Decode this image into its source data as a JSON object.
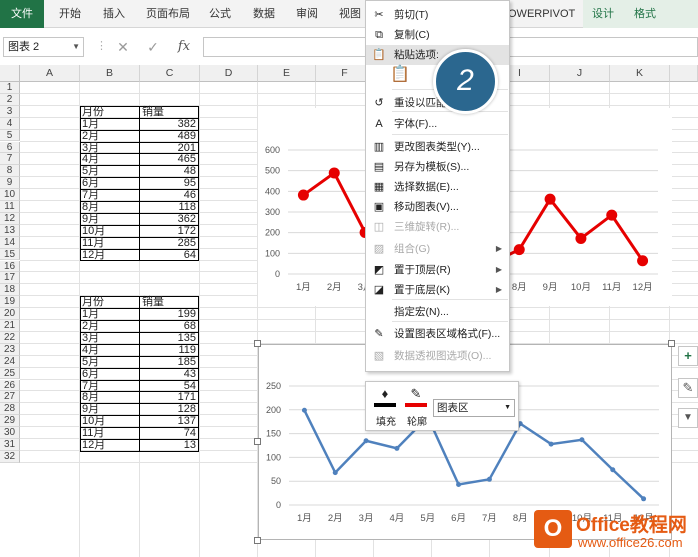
{
  "ribbon": {
    "tabs": [
      "文件",
      "开始",
      "插入",
      "页面布局",
      "公式",
      "数据",
      "审阅",
      "视图"
    ],
    "tab_partial": "OWERPIVOT",
    "context_tabs": [
      "设计",
      "格式"
    ]
  },
  "formula_bar": {
    "name_box": "图表 2",
    "cancel_icon": "✕",
    "enter_icon": "✓",
    "fx_label": "fx",
    "value": ""
  },
  "columns": [
    "A",
    "B",
    "C",
    "D",
    "E",
    "F",
    "G",
    "H",
    "I",
    "J",
    "K"
  ],
  "rows": [
    "1",
    "2",
    "3",
    "4",
    "5",
    "6",
    "7",
    "8",
    "9",
    "10",
    "11",
    "12",
    "13",
    "14",
    "15",
    "16",
    "17",
    "18",
    "19",
    "20",
    "21",
    "22",
    "23",
    "24",
    "25",
    "26",
    "27",
    "28",
    "29",
    "30",
    "31",
    "32"
  ],
  "table1": {
    "headers": [
      "月份",
      "销量"
    ],
    "rows": [
      [
        "1月",
        "382"
      ],
      [
        "2月",
        "489"
      ],
      [
        "3月",
        "201"
      ],
      [
        "4月",
        "465"
      ],
      [
        "5月",
        "48"
      ],
      [
        "6月",
        "95"
      ],
      [
        "7月",
        "46"
      ],
      [
        "8月",
        "118"
      ],
      [
        "9月",
        "362"
      ],
      [
        "10月",
        "172"
      ],
      [
        "11月",
        "285"
      ],
      [
        "12月",
        "64"
      ]
    ]
  },
  "table2": {
    "headers": [
      "月份",
      "销量"
    ],
    "rows": [
      [
        "1月",
        "199"
      ],
      [
        "2月",
        "68"
      ],
      [
        "3月",
        "135"
      ],
      [
        "4月",
        "119"
      ],
      [
        "5月",
        "185"
      ],
      [
        "6月",
        "43"
      ],
      [
        "7月",
        "54"
      ],
      [
        "8月",
        "171"
      ],
      [
        "9月",
        "128"
      ],
      [
        "10月",
        "137"
      ],
      [
        "11月",
        "74"
      ],
      [
        "12月",
        "13"
      ]
    ]
  },
  "chart_data": [
    {
      "type": "line",
      "categories": [
        "1月",
        "2月",
        "3月",
        "4月",
        "5月",
        "6月",
        "7月",
        "8月",
        "9月",
        "10月",
        "11月",
        "12月"
      ],
      "series": [
        {
          "values": [
            382,
            489,
            201,
            465,
            48,
            95,
            46,
            118,
            362,
            172,
            285,
            64
          ]
        }
      ],
      "yticks": [
        0,
        100,
        200,
        300,
        400,
        500,
        600
      ],
      "ylim": [
        0,
        600
      ],
      "color": "#e60000",
      "markers": true
    },
    {
      "type": "line",
      "categories": [
        "1月",
        "2月",
        "3月",
        "4月",
        "5月",
        "6月",
        "7月",
        "8月",
        "9月",
        "10月",
        "11月",
        "12月"
      ],
      "series": [
        {
          "values": [
            199,
            68,
            135,
            119,
            185,
            43,
            54,
            171,
            128,
            137,
            74,
            13
          ]
        }
      ],
      "yticks": [
        0,
        50,
        100,
        150,
        200,
        250
      ],
      "ylim": [
        0,
        250
      ],
      "color": "#4f81bd",
      "markers": true
    }
  ],
  "context_menu": {
    "items": [
      {
        "label": "剪切(T)",
        "icon": "✂",
        "disabled": false,
        "arrow": false
      },
      {
        "label": "复制(C)",
        "icon": "⧉",
        "disabled": false,
        "arrow": false
      },
      {
        "label": "粘贴选项:",
        "icon": "📋",
        "disabled": false,
        "arrow": false
      },
      {
        "label": "",
        "icon": "📋",
        "disabled": false,
        "arrow": false
      },
      {
        "label": "重设以匹配样式(A)",
        "icon": "↺",
        "disabled": false,
        "arrow": false
      },
      {
        "label": "字体(F)...",
        "icon": "A",
        "disabled": false,
        "arrow": false
      },
      {
        "label": "更改图表类型(Y)...",
        "icon": "▥",
        "disabled": false,
        "arrow": false
      },
      {
        "label": "另存为模板(S)...",
        "icon": "▤",
        "disabled": false,
        "arrow": false
      },
      {
        "label": "选择数据(E)...",
        "icon": "▦",
        "disabled": false,
        "arrow": false
      },
      {
        "label": "移动图表(V)...",
        "icon": "▣",
        "disabled": false,
        "arrow": false
      },
      {
        "label": "三维旋转(R)...",
        "icon": "◫",
        "disabled": true,
        "arrow": false
      },
      {
        "label": "组合(G)",
        "icon": "▨",
        "disabled": true,
        "arrow": true
      },
      {
        "label": "置于顶层(R)",
        "icon": "◩",
        "disabled": false,
        "arrow": true
      },
      {
        "label": "置于底层(K)",
        "icon": "◪",
        "disabled": false,
        "arrow": true
      },
      {
        "label": "指定宏(N)...",
        "icon": "",
        "disabled": false,
        "arrow": false
      },
      {
        "label": "设置图表区域格式(F)...",
        "icon": "✎",
        "disabled": false,
        "arrow": false
      },
      {
        "label": "数据透视图选项(O)...",
        "icon": "▧",
        "disabled": true,
        "arrow": false
      }
    ]
  },
  "step_badge": "2",
  "mini_toolbar": {
    "fill_label": "填充",
    "outline_label": "轮廓",
    "element_select": "图表区"
  },
  "side_buttons": [
    "+",
    "✎",
    "▼"
  ],
  "watermark": {
    "brand": "Office教程网",
    "url": "www.office26.com"
  }
}
